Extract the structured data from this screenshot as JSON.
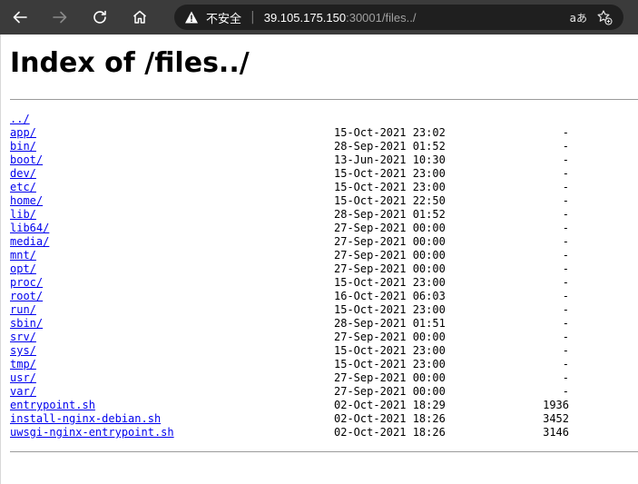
{
  "browser": {
    "security_label": "不安全",
    "url_host": "39.105.175.150",
    "url_rest": ":30001/files../",
    "read_aloud_label": "aあ"
  },
  "page": {
    "title": "Index of /files../"
  },
  "entries": [
    {
      "name": "../",
      "date": "",
      "size": ""
    },
    {
      "name": "app/",
      "date": "15-Oct-2021 23:02",
      "size": "-"
    },
    {
      "name": "bin/",
      "date": "28-Sep-2021 01:52",
      "size": "-"
    },
    {
      "name": "boot/",
      "date": "13-Jun-2021 10:30",
      "size": "-"
    },
    {
      "name": "dev/",
      "date": "15-Oct-2021 23:00",
      "size": "-"
    },
    {
      "name": "etc/",
      "date": "15-Oct-2021 23:00",
      "size": "-"
    },
    {
      "name": "home/",
      "date": "15-Oct-2021 22:50",
      "size": "-"
    },
    {
      "name": "lib/",
      "date": "28-Sep-2021 01:52",
      "size": "-"
    },
    {
      "name": "lib64/",
      "date": "27-Sep-2021 00:00",
      "size": "-"
    },
    {
      "name": "media/",
      "date": "27-Sep-2021 00:00",
      "size": "-"
    },
    {
      "name": "mnt/",
      "date": "27-Sep-2021 00:00",
      "size": "-"
    },
    {
      "name": "opt/",
      "date": "27-Sep-2021 00:00",
      "size": "-"
    },
    {
      "name": "proc/",
      "date": "15-Oct-2021 23:00",
      "size": "-"
    },
    {
      "name": "root/",
      "date": "16-Oct-2021 06:03",
      "size": "-"
    },
    {
      "name": "run/",
      "date": "15-Oct-2021 23:00",
      "size": "-"
    },
    {
      "name": "sbin/",
      "date": "28-Sep-2021 01:51",
      "size": "-"
    },
    {
      "name": "srv/",
      "date": "27-Sep-2021 00:00",
      "size": "-"
    },
    {
      "name": "sys/",
      "date": "15-Oct-2021 23:00",
      "size": "-"
    },
    {
      "name": "tmp/",
      "date": "15-Oct-2021 23:00",
      "size": "-"
    },
    {
      "name": "usr/",
      "date": "27-Sep-2021 00:00",
      "size": "-"
    },
    {
      "name": "var/",
      "date": "27-Sep-2021 00:00",
      "size": "-"
    },
    {
      "name": "entrypoint.sh",
      "date": "02-Oct-2021 18:29",
      "size": "1936"
    },
    {
      "name": "install-nginx-debian.sh",
      "date": "02-Oct-2021 18:26",
      "size": "3452"
    },
    {
      "name": "uwsgi-nginx-entrypoint.sh",
      "date": "02-Oct-2021 18:26",
      "size": "3146"
    }
  ],
  "colors": {
    "toolbar": "#3b3b3b",
    "link": "#0000ee"
  },
  "icons": [
    "back-icon",
    "forward-icon",
    "refresh-icon",
    "home-icon",
    "warning-icon",
    "favorite-add-icon"
  ]
}
